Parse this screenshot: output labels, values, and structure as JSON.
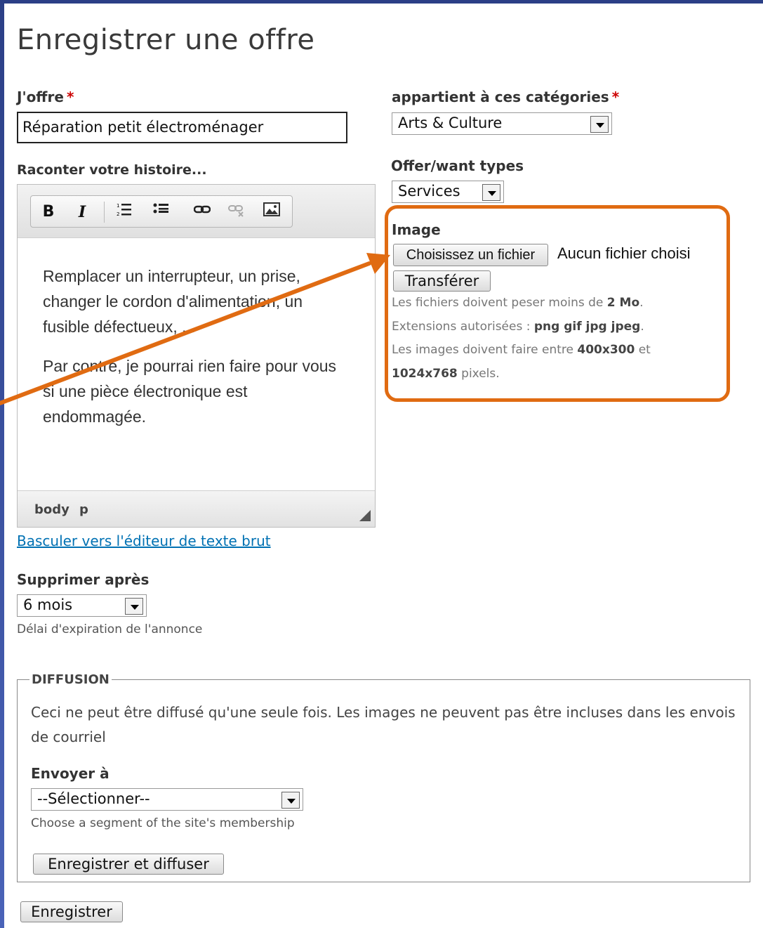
{
  "page_title": "Enregistrer une offre",
  "offer": {
    "label": "J'offre",
    "required_mark": "*",
    "value": "Réparation petit électroménager"
  },
  "categories": {
    "label": "appartient à ces catégories",
    "required_mark": "*",
    "selected": "Arts & Culture"
  },
  "offer_types": {
    "label": "Offer/want types",
    "selected": "Services"
  },
  "story": {
    "label": "Raconter votre histoire...",
    "toolbar": {
      "bold": "B",
      "italic": "I",
      "numbered_list_icon": "numbered-list",
      "bullet_list_icon": "bullet-list",
      "link_icon": "link",
      "unlink_icon": "unlink",
      "image_icon": "image"
    },
    "paragraphs": [
      "Remplacer un interrupteur, un prise, changer le cordon d'alimentation, un fusible défectueux, ...",
      "Par contre, je pourrai rien faire pour vous si une pièce électronique est endommagée."
    ],
    "status_path": [
      "body",
      "p"
    ]
  },
  "toggle_editor_link": "Basculer vers l'éditeur de texte brut",
  "image": {
    "label": "Image",
    "choose_button": "Choisissez un fichier",
    "no_file_text": "Aucun fichier choisi",
    "upload_button": "Transférer",
    "size_text": "Les fichiers doivent peser moins de",
    "size_value": "2 Mo",
    "extensions_text": "Extensions autorisées :",
    "extensions_value": "png gif jpg jpeg",
    "dims_text_1": "Les images doivent faire entre",
    "dims_min": "400x300",
    "dims_and": "et",
    "dims_max": "1024x768",
    "dims_unit": "pixels",
    "highlight_color": "#e06b12"
  },
  "expiry": {
    "label": "Supprimer après",
    "selected": "6 mois",
    "description": "Délai d'expiration de l'annonce"
  },
  "diffusion": {
    "legend": "DIFFUSION",
    "text": "Ceci ne peut être diffusé qu'une seule fois. Les images ne peuvent pas être incluses dans les envois de courriel",
    "send_to_label": "Envoyer à",
    "send_to_selected": "--Sélectionner--",
    "send_to_description": "Choose a segment of the site's membership",
    "save_and_send_button": "Enregistrer et diffuser"
  },
  "save_button": "Enregistrer",
  "colors": {
    "frame": "#2b3f86",
    "link": "#0071b3",
    "required": "#cc0000",
    "annotation": "#e06b12"
  }
}
